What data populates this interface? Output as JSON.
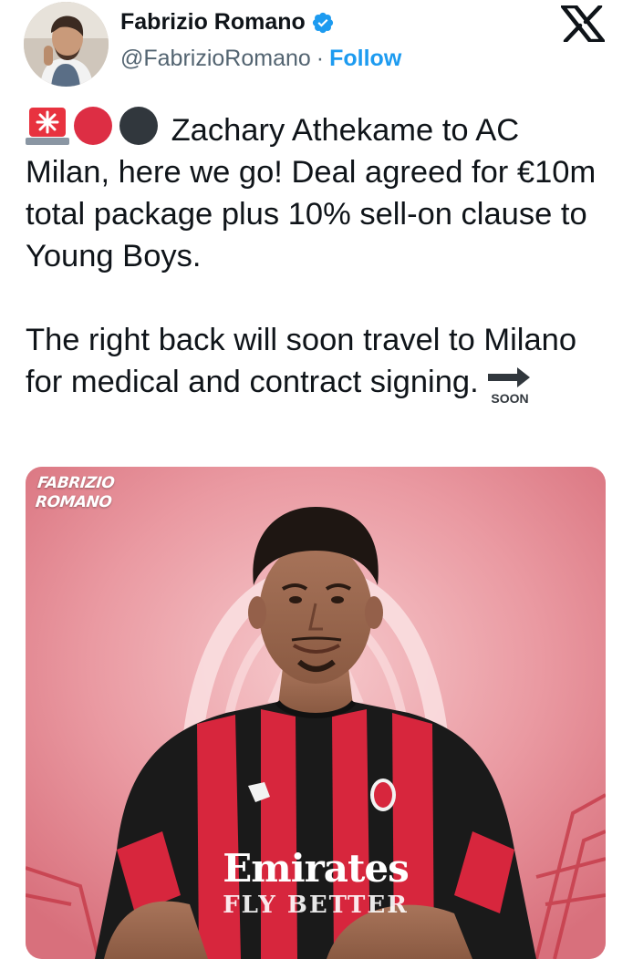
{
  "author": {
    "name": "Fabrizio Romano",
    "handle": "@FabrizioRomano",
    "separator": "·",
    "follow_label": "Follow",
    "verified_icon": "verified-badge-icon",
    "verified_color": "#1d9bf0"
  },
  "platform_icon": "x-logo-icon",
  "tweet": {
    "emojis": [
      "rotating-light-icon",
      "red-circle-icon",
      "black-circle-icon"
    ],
    "paragraph_1": "Zachary Athekame to AC Milan, here we go! Deal agreed for €10m total package plus 10% sell-on clause to Young Boys.",
    "paragraph_2": "The right back will soon travel to Milano for medical and contract signing.",
    "soon_emoji_label": "SOON"
  },
  "media": {
    "watermark_line1": "FABRIZIO",
    "watermark_line2": "ROMANO",
    "shirt_sponsor_line1": "Emirates",
    "shirt_sponsor_line2": "FLY BETTER"
  },
  "colors": {
    "link": "#1d9bf0",
    "text": "#0f1419",
    "secondary": "#536471",
    "milan_red": "#d7263d"
  }
}
